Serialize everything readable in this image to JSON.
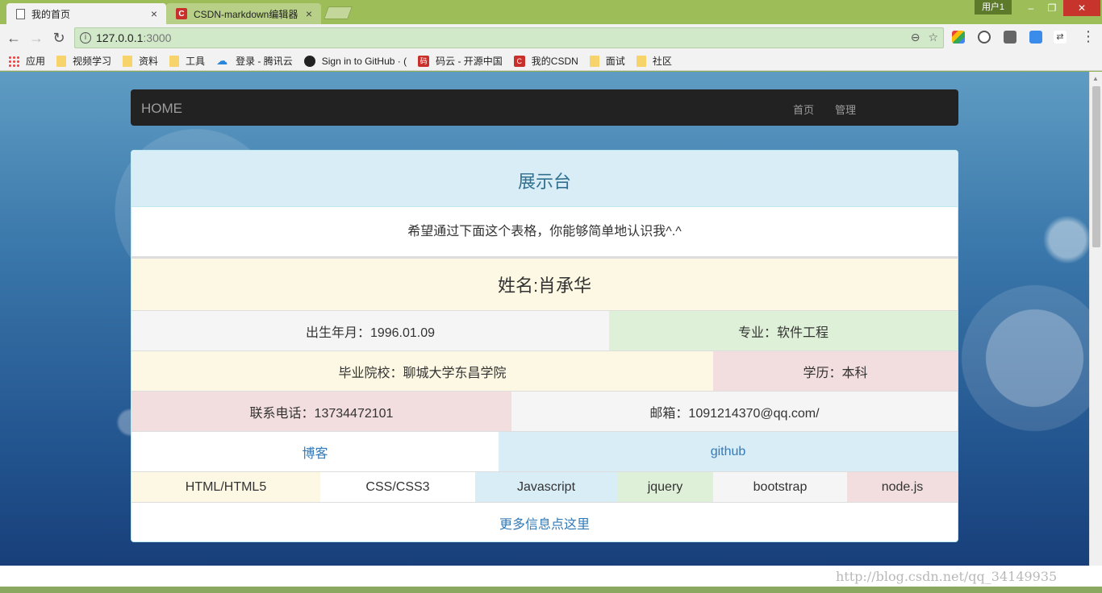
{
  "browser": {
    "tabs": [
      {
        "label": "我的首页",
        "close": "×"
      },
      {
        "label": "CSDN-markdown编辑器",
        "close": "×"
      }
    ],
    "user_badge": "用户1",
    "window_controls": {
      "minimize": "–",
      "maximize": "❐",
      "close": "✕"
    },
    "nav": {
      "back": "←",
      "forward": "→",
      "reload": "↻"
    },
    "url": {
      "host": "127.0.0.1",
      "port": ":3000"
    },
    "omni_icons": {
      "zoom": "⊖",
      "star": "☆"
    },
    "menu": "⋮",
    "bookmarks": [
      {
        "label": "应用",
        "icon": "apps-icon"
      },
      {
        "label": "视频学习",
        "icon": "folder-icon"
      },
      {
        "label": "资料",
        "icon": "folder-icon"
      },
      {
        "label": "工具",
        "icon": "folder-icon"
      },
      {
        "label": "登录 - 腾讯云",
        "icon": "cloud-icon"
      },
      {
        "label": "Sign in to GitHub · (",
        "icon": "github-icon"
      },
      {
        "label": "码云 - 开源中国",
        "icon": "gitee-icon"
      },
      {
        "label": "我的CSDN",
        "icon": "csdn-icon"
      },
      {
        "label": "面试",
        "icon": "folder-icon"
      },
      {
        "label": "社区",
        "icon": "folder-icon"
      }
    ]
  },
  "navbar": {
    "brand": "HOME",
    "links": [
      "首页",
      "管理"
    ]
  },
  "panel": {
    "heading": "展示台",
    "intro": "希望通过下面这个表格，你能够简单地认识我^.^",
    "name": "姓名:肖承华",
    "birth": "出生年月：1996.01.09",
    "major": "专业：软件工程",
    "school": "毕业院校：聊城大学东昌学院",
    "degree": "学历：本科",
    "phone": "联系电话：13734472101",
    "email": "邮箱：1091214370@qq.com/",
    "blog": "博客",
    "github": "github",
    "skills": [
      "HTML/HTML5",
      "CSS/CSS3",
      "Javascript",
      "jquery",
      "bootstrap",
      "node.js"
    ],
    "more": "更多信息点这里"
  },
  "watermark": "http://blog.csdn.net/qq_34149935"
}
